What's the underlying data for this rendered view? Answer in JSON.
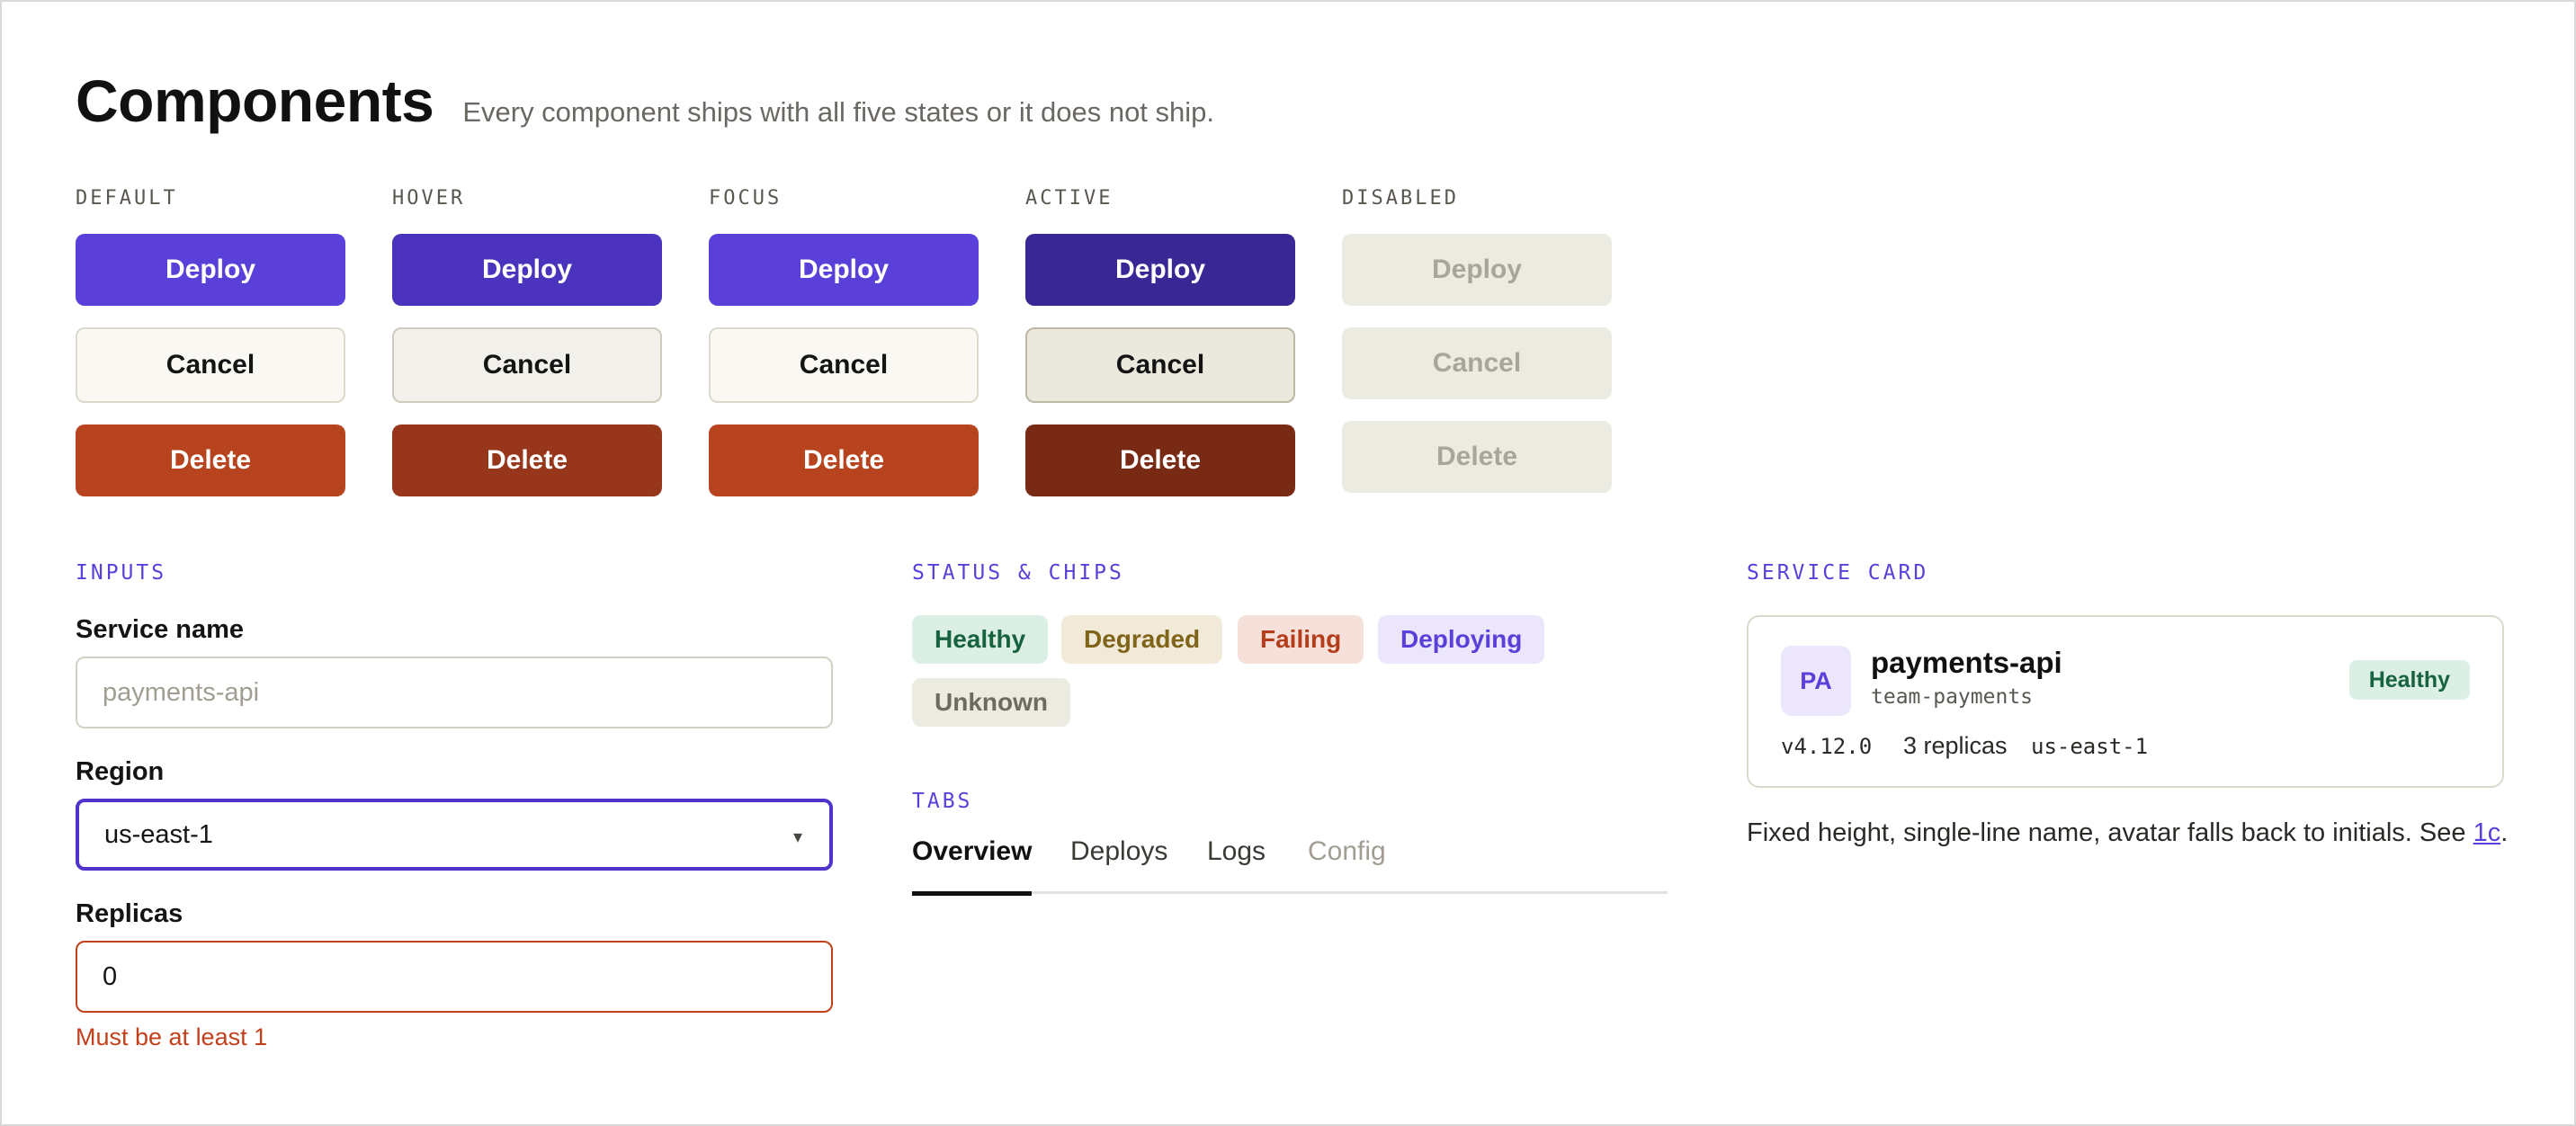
{
  "header": {
    "title": "Components",
    "subtitle": "Every component ships with all five states or it does not ship."
  },
  "button_states": [
    {
      "label": "DEFAULT",
      "primary": "Deploy",
      "secondary": "Cancel",
      "danger": "Delete"
    },
    {
      "label": "HOVER",
      "primary": "Deploy",
      "secondary": "Cancel",
      "danger": "Delete"
    },
    {
      "label": "FOCUS",
      "primary": "Deploy",
      "secondary": "Cancel",
      "danger": "Delete"
    },
    {
      "label": "ACTIVE",
      "primary": "Deploy",
      "secondary": "Cancel",
      "danger": "Delete"
    },
    {
      "label": "DISABLED",
      "primary": "Deploy",
      "secondary": "Cancel",
      "danger": "Delete"
    }
  ],
  "inputs": {
    "section_label": "INPUTS",
    "service_name": {
      "label": "Service name",
      "placeholder": "payments-api",
      "value": ""
    },
    "region": {
      "label": "Region",
      "value": "us-east-1",
      "chevron": "▾"
    },
    "replicas": {
      "label": "Replicas",
      "value": "0",
      "error": "Must be at least 1"
    }
  },
  "status": {
    "section_label": "STATUS & CHIPS",
    "chips": [
      "Healthy",
      "Degraded",
      "Failing",
      "Deploying",
      "Unknown"
    ]
  },
  "tabs": {
    "section_label": "TABS",
    "items": [
      "Overview",
      "Deploys",
      "Logs",
      "Config"
    ],
    "selected": "Overview"
  },
  "service_card": {
    "section_label": "SERVICE CARD",
    "initials": "PA",
    "name": "payments-api",
    "team": "team-payments",
    "status": "Healthy",
    "version": "v4.12.0",
    "replicas": "3 replicas",
    "region": "us-east-1",
    "note_prefix": "Fixed height, single-line name, avatar falls back to initials. See ",
    "note_link": "1c",
    "note_suffix": "."
  },
  "colors": {
    "accent": "#5a3fd9",
    "danger": "#b7441f",
    "healthy": "#17623f",
    "error": "#c2401c"
  }
}
